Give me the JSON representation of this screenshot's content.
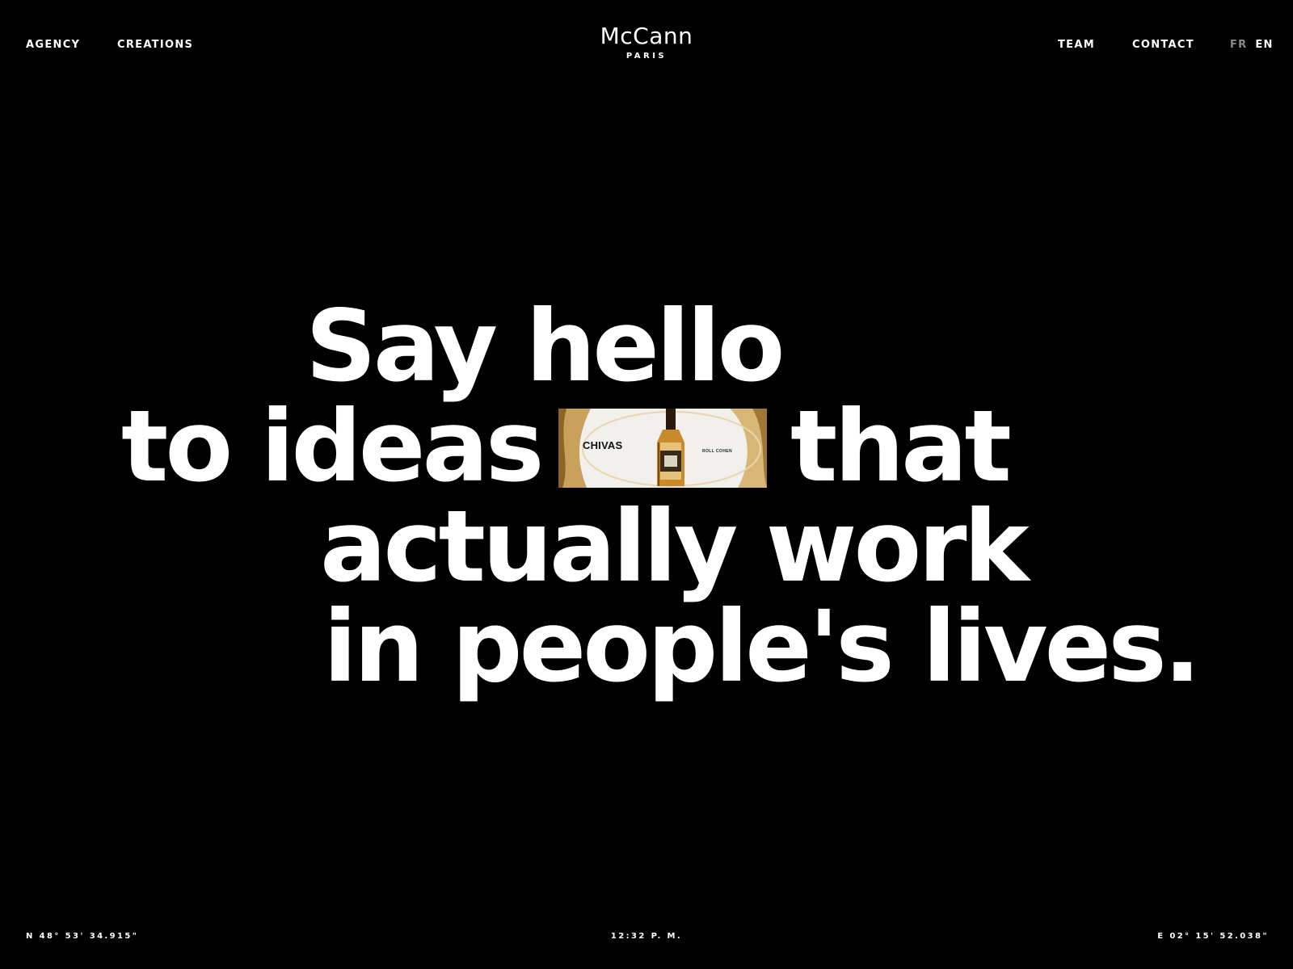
{
  "nav": {
    "agency": "AGENCY",
    "creations": "CREATIONS",
    "team": "TEAM",
    "contact": "CONTACT"
  },
  "lang": {
    "fr": "FR",
    "en": "EN",
    "active": "EN"
  },
  "logo": {
    "name": "McCann",
    "city": "PARIS"
  },
  "headline": {
    "line1": "Say hello",
    "line2_start": "to ideas",
    "line2_end": "that",
    "line3": "actually work",
    "line4": "in people's lives."
  },
  "thumbnail": {
    "brand": "CHIVAS",
    "caption": "ROLL COHEN"
  },
  "footer": {
    "latitude": "N 48° 53' 34.915\"",
    "time": "12:32 P. M.",
    "longitude": "E 02° 15' 52.038\""
  },
  "colors": {
    "background": "#000000",
    "text": "#ffffff",
    "inactive_lang": "#8a8a8a"
  }
}
